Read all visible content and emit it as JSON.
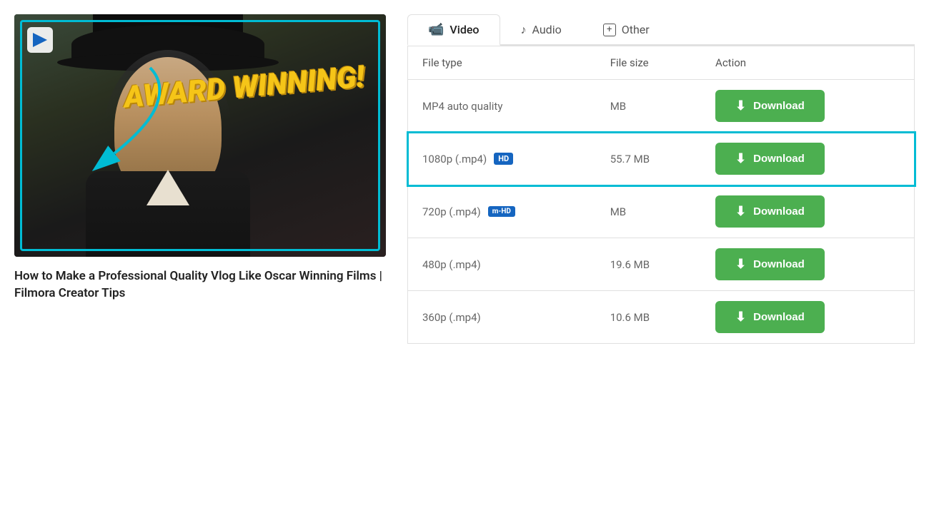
{
  "tabs": [
    {
      "id": "video",
      "label": "Video",
      "icon": "video-icon",
      "active": true
    },
    {
      "id": "audio",
      "label": "Audio",
      "icon": "audio-icon",
      "active": false
    },
    {
      "id": "other",
      "label": "Other",
      "icon": "other-icon",
      "active": false
    }
  ],
  "table": {
    "headers": [
      "File type",
      "File size",
      "Action"
    ],
    "rows": [
      {
        "fileType": "MP4 auto quality",
        "badge": null,
        "fileSize": "MB",
        "action": "Download"
      },
      {
        "fileType": "1080p (.mp4)",
        "badge": "HD",
        "badgeClass": "hd",
        "fileSize": "55.7 MB",
        "action": "Download",
        "highlighted": true
      },
      {
        "fileType": "720p (.mp4)",
        "badge": "m-HD",
        "badgeClass": "mhd",
        "fileSize": "MB",
        "action": "Download"
      },
      {
        "fileType": "480p (.mp4)",
        "badge": null,
        "fileSize": "19.6 MB",
        "action": "Download"
      },
      {
        "fileType": "360p (.mp4)",
        "badge": null,
        "fileSize": "10.6 MB",
        "action": "Download"
      }
    ]
  },
  "videoTitle": "How to Make a Professional Quality Vlog Like Oscar Winning Films | Filmora Creator Tips",
  "awardText": "AWARD WINNING!",
  "downloadLabel": "Download",
  "colors": {
    "downloadBtn": "#4caf50",
    "tabBorderActive": "#e0e0e0",
    "highlightBorder": "#00bcd4",
    "hdBadge": "#1565c0"
  }
}
